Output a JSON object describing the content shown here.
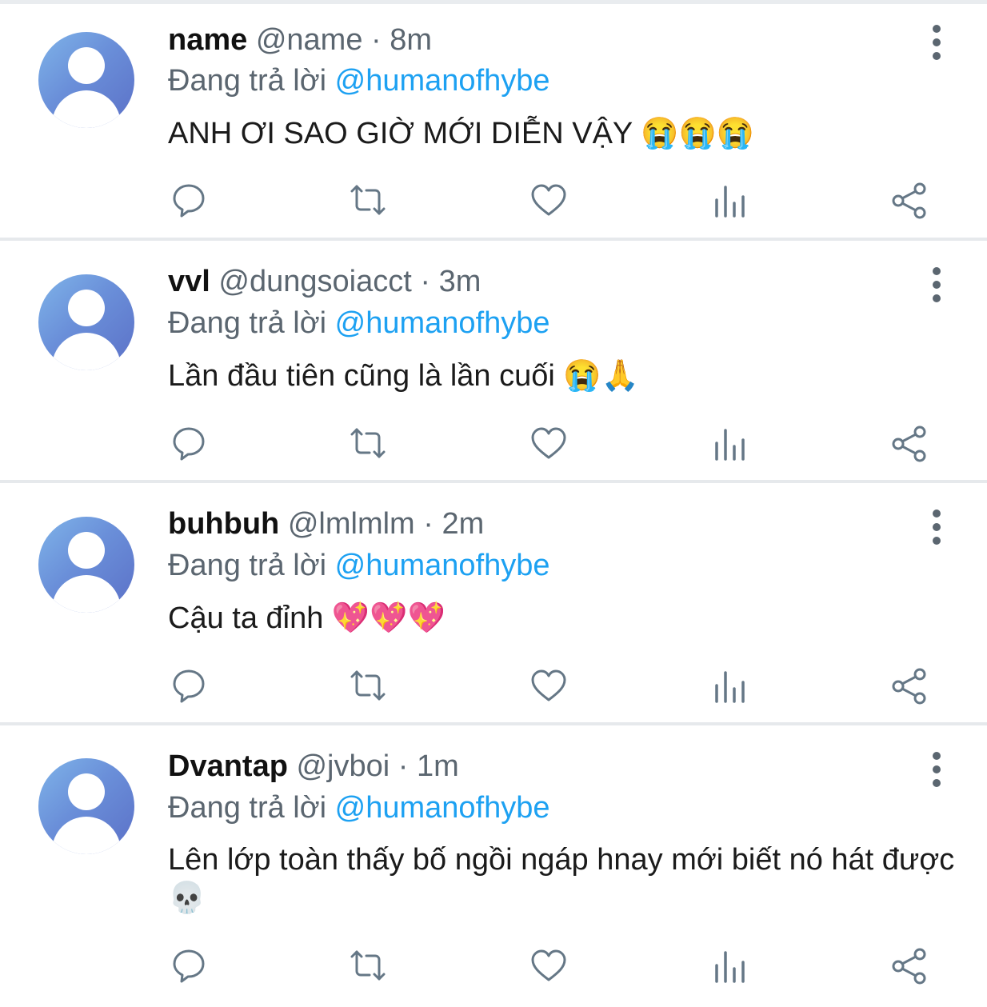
{
  "reply_prefix": "Đang trả lời",
  "tweets": [
    {
      "name": "name",
      "handle": "@name",
      "separator": "·",
      "time": "8m",
      "reply_to": "@humanofhybe",
      "text": "ANH ƠI SAO GIỜ MỚI DIỄN VẬY 😭😭😭"
    },
    {
      "name": "vvl",
      "handle": "@dungsoiacct",
      "separator": "·",
      "time": "3m",
      "reply_to": "@humanofhybe",
      "text": "Lần đầu tiên cũng là lần cuối 😭🙏"
    },
    {
      "name": "buhbuh",
      "handle": "@lmlmlm",
      "separator": "·",
      "time": "2m",
      "reply_to": "@humanofhybe",
      "text": "Cậu ta đỉnh 💖💖💖"
    },
    {
      "name": "Dvantap",
      "handle": "@jvboi",
      "separator": "·",
      "time": "1m",
      "reply_to": "@humanofhybe",
      "text": "Lên lớp toàn thấy bố ngồi ngáp hnay mới biết nó hát được 💀"
    }
  ],
  "icons": {
    "reply": "speech-bubble-icon",
    "retweet": "retweet-icon",
    "like": "heart-icon",
    "views": "bar-chart-icon",
    "share": "share-icon",
    "more": "vertical-dots-icon",
    "avatar": "default-avatar"
  },
  "colors": {
    "mention": "#1da1f2",
    "muted": "#5b6670",
    "icon": "#657786",
    "avatar": "#6a8fd9"
  }
}
